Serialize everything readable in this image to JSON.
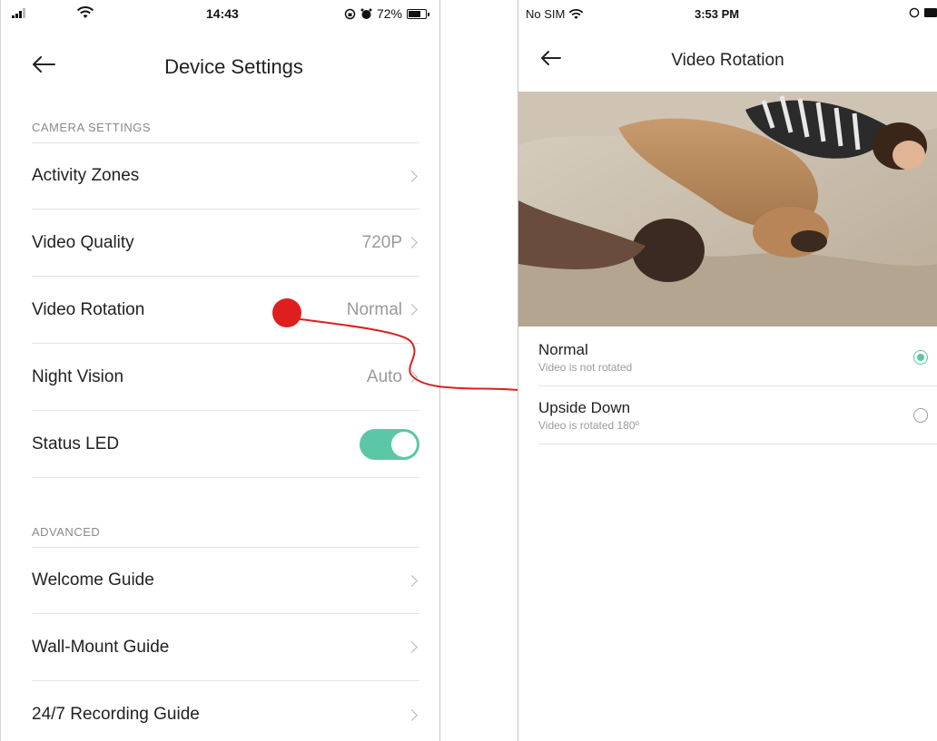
{
  "colors": {
    "accent": "#5cc7a6",
    "annotation": "#dd1f1f"
  },
  "left_phone": {
    "status": {
      "time": "14:43",
      "battery": "72%",
      "battery_level": 0.72
    },
    "nav": {
      "title": "Device Settings",
      "back_icon": "back-arrow-icon"
    },
    "sections": {
      "camera": {
        "header": "CAMERA SETTINGS",
        "rows": [
          {
            "label": "Activity Zones",
            "value": ""
          },
          {
            "label": "Video Quality",
            "value": "720P"
          },
          {
            "label": "Video Rotation",
            "value": "Normal"
          },
          {
            "label": "Night Vision",
            "value": "Auto"
          },
          {
            "label": "Status LED",
            "toggle": true
          }
        ]
      },
      "advanced": {
        "header": "ADVANCED",
        "rows": [
          {
            "label": "Welcome Guide"
          },
          {
            "label": "Wall-Mount Guide"
          },
          {
            "label": "24/7 Recording Guide"
          }
        ]
      }
    }
  },
  "right_phone": {
    "status": {
      "carrier": "No SIM",
      "time": "3:53 PM"
    },
    "nav": {
      "title": "Video Rotation",
      "back_icon": "back-arrow-icon"
    },
    "options": [
      {
        "title": "Normal",
        "subtitle": "Video is not rotated",
        "selected": true
      },
      {
        "title": "Upside Down",
        "subtitle": "Video is rotated 180º",
        "selected": false
      }
    ]
  }
}
